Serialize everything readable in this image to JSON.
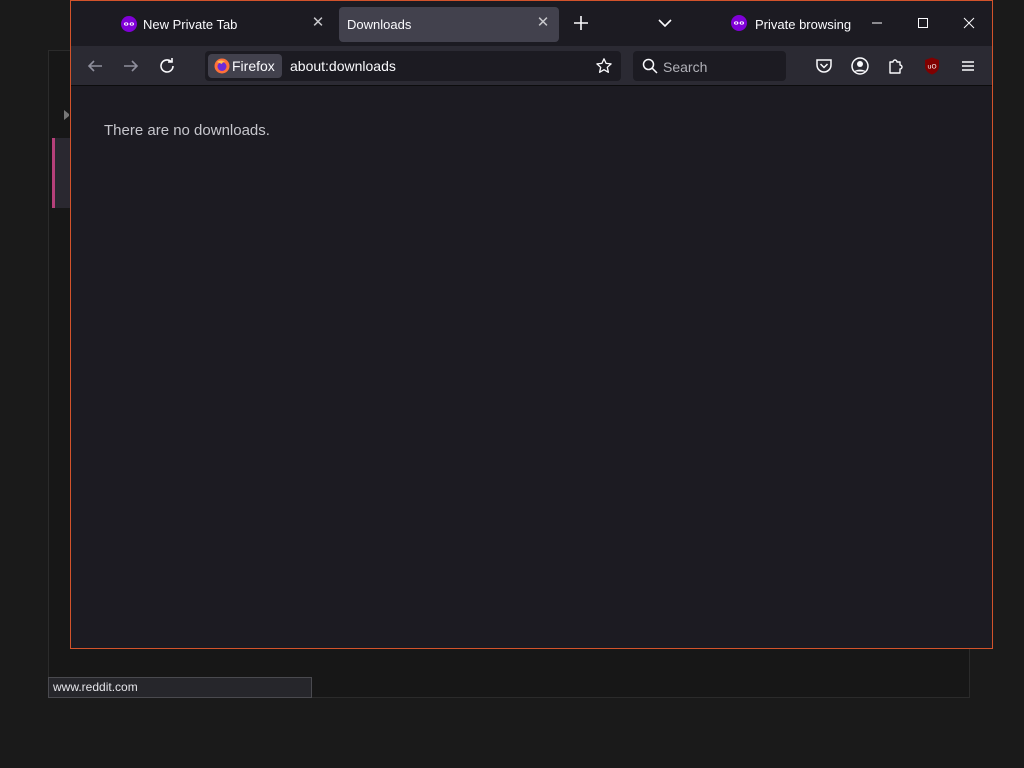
{
  "background_window": {
    "status_url": "www.reddit.com"
  },
  "tabs": [
    {
      "label": "New Private Tab",
      "icon": "private-mask-icon",
      "active": false
    },
    {
      "label": "Downloads",
      "active": true
    }
  ],
  "private_indicator": {
    "label": "Private browsing",
    "icon": "private-mask-icon"
  },
  "navbar": {
    "identity_label": "Firefox",
    "url": "about:downloads",
    "search_placeholder": "Search"
  },
  "content": {
    "empty_message": "There are no downloads."
  },
  "colors": {
    "window_border": "#d2532b",
    "private_purple": "#8000d7",
    "active_tab": "#42414d",
    "content_bg": "#1c1b22"
  }
}
